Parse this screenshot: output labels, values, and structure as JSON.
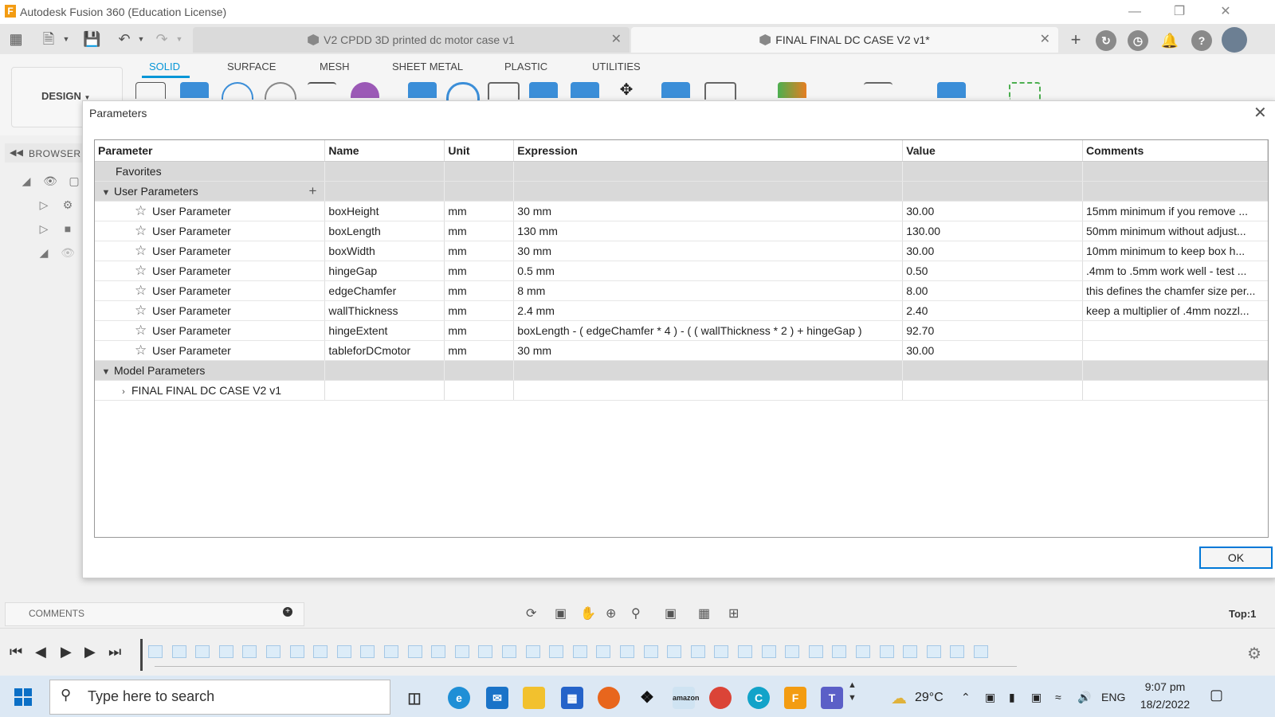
{
  "window": {
    "title": "Autodesk Fusion 360 (Education License)"
  },
  "tabs": [
    {
      "label": "V2 CPDD 3D printed dc motor case v1"
    },
    {
      "label": "FINAL FINAL DC CASE V2 v1*"
    }
  ],
  "ribbon": {
    "tabs": [
      "SOLID",
      "SURFACE",
      "MESH",
      "SHEET METAL",
      "PLASTIC",
      "UTILITIES"
    ],
    "design": "DESIGN"
  },
  "browser": {
    "label": "BROWSER"
  },
  "dialog": {
    "title": "Parameters",
    "columns": [
      "Parameter",
      "Name",
      "Unit",
      "Expression",
      "Value",
      "Comments"
    ],
    "groups": {
      "favorites": "Favorites",
      "user": "User Parameters",
      "model": "Model Parameters"
    },
    "rows": [
      {
        "param": "User Parameter",
        "name": "boxHeight",
        "unit": "mm",
        "expr": "30 mm",
        "value": "30.00",
        "comment": "15mm minimum if you remove ..."
      },
      {
        "param": "User Parameter",
        "name": "boxLength",
        "unit": "mm",
        "expr": "130 mm",
        "value": "130.00",
        "comment": "50mm minimum without adjust..."
      },
      {
        "param": "User Parameter",
        "name": "boxWidth",
        "unit": "mm",
        "expr": "30 mm",
        "value": "30.00",
        "comment": "10mm minimum to keep box h..."
      },
      {
        "param": "User Parameter",
        "name": "hingeGap",
        "unit": "mm",
        "expr": "0.5 mm",
        "value": "0.50",
        "comment": ".4mm to .5mm work well - test ..."
      },
      {
        "param": "User Parameter",
        "name": "edgeChamfer",
        "unit": "mm",
        "expr": "8 mm",
        "value": "8.00",
        "comment": "this defines the chamfer size per..."
      },
      {
        "param": "User Parameter",
        "name": "wallThickness",
        "unit": "mm",
        "expr": "2.4 mm",
        "value": "2.40",
        "comment": "keep a multiplier of .4mm nozzl..."
      },
      {
        "param": "User Parameter",
        "name": "hingeExtent",
        "unit": "mm",
        "expr": "boxLength - ( edgeChamfer * 4 ) - ( ( wallThickness * 2 ) + hingeGap )",
        "value": "92.70",
        "comment": ""
      },
      {
        "param": "User Parameter",
        "name": "tableforDCmotor",
        "unit": "mm",
        "expr": "30 mm",
        "value": "30.00",
        "comment": ""
      }
    ],
    "model_item": "FINAL FINAL DC CASE V2 v1",
    "ok": "OK"
  },
  "comments": {
    "label": "COMMENTS"
  },
  "viewcube": {
    "label": "Top:1"
  },
  "taskbar": {
    "search_placeholder": "Type here to search",
    "weather": "29°C",
    "lang": "ENG",
    "time": "9:07 pm",
    "date": "18/2/2022"
  },
  "colors": {
    "accent": "#0696d7",
    "ok_border": "#0078d7",
    "group_bg": "#d9d9d9"
  }
}
